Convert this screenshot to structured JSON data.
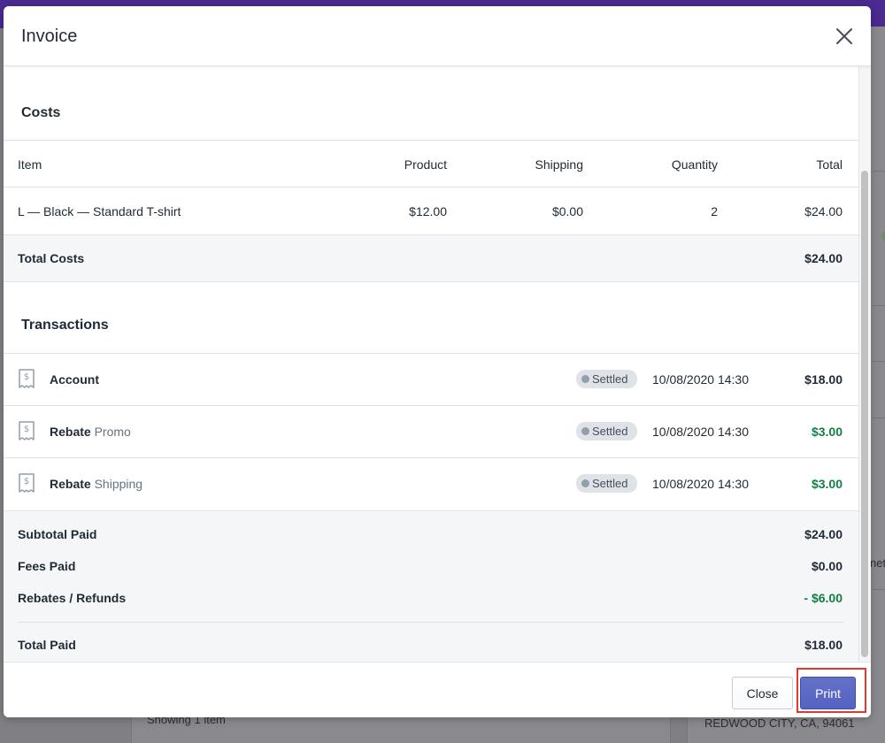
{
  "background": {
    "right_text_1": "net",
    "right_address": "REDWOOD CITY, CA, 94061",
    "left_footer_text": "Showing 1 item"
  },
  "modal": {
    "title": "Invoice",
    "close_icon": "close-icon"
  },
  "costs": {
    "title": "Costs",
    "columns": {
      "item": "Item",
      "product": "Product",
      "shipping": "Shipping",
      "quantity": "Quantity",
      "total": "Total"
    },
    "rows": [
      {
        "item": "L — Black — Standard T-shirt",
        "product": "$12.00",
        "shipping": "$0.00",
        "quantity": "2",
        "total": "$24.00"
      }
    ],
    "total_label": "Total Costs",
    "total_value": "$24.00"
  },
  "transactions": {
    "title": "Transactions",
    "rows": [
      {
        "icon": "receipt-icon",
        "label": "Account",
        "sublabel": "",
        "status": "Settled",
        "datetime": "10/08/2020 14:30",
        "amount": "$18.00"
      },
      {
        "icon": "receipt-icon",
        "label": "Rebate",
        "sublabel": "Promo",
        "status": "Settled",
        "datetime": "10/08/2020 14:30",
        "amount": "$3.00"
      },
      {
        "icon": "receipt-icon",
        "label": "Rebate",
        "sublabel": "Shipping",
        "status": "Settled",
        "datetime": "10/08/2020 14:30",
        "amount": "$3.00"
      }
    ]
  },
  "summary": {
    "subtotal_label": "Subtotal Paid",
    "subtotal_value": "$24.00",
    "fees_label": "Fees Paid",
    "fees_value": "$0.00",
    "rebates_label": "Rebates / Refunds",
    "rebates_value": "- $6.00",
    "total_label": "Total Paid",
    "total_value": "$18.00"
  },
  "footer": {
    "close_label": "Close",
    "print_label": "Print"
  },
  "colors": {
    "accent": "#5c6ac4",
    "positive": "#108043",
    "highlight": "#e03a2e",
    "topbar": "#4b2a91"
  }
}
